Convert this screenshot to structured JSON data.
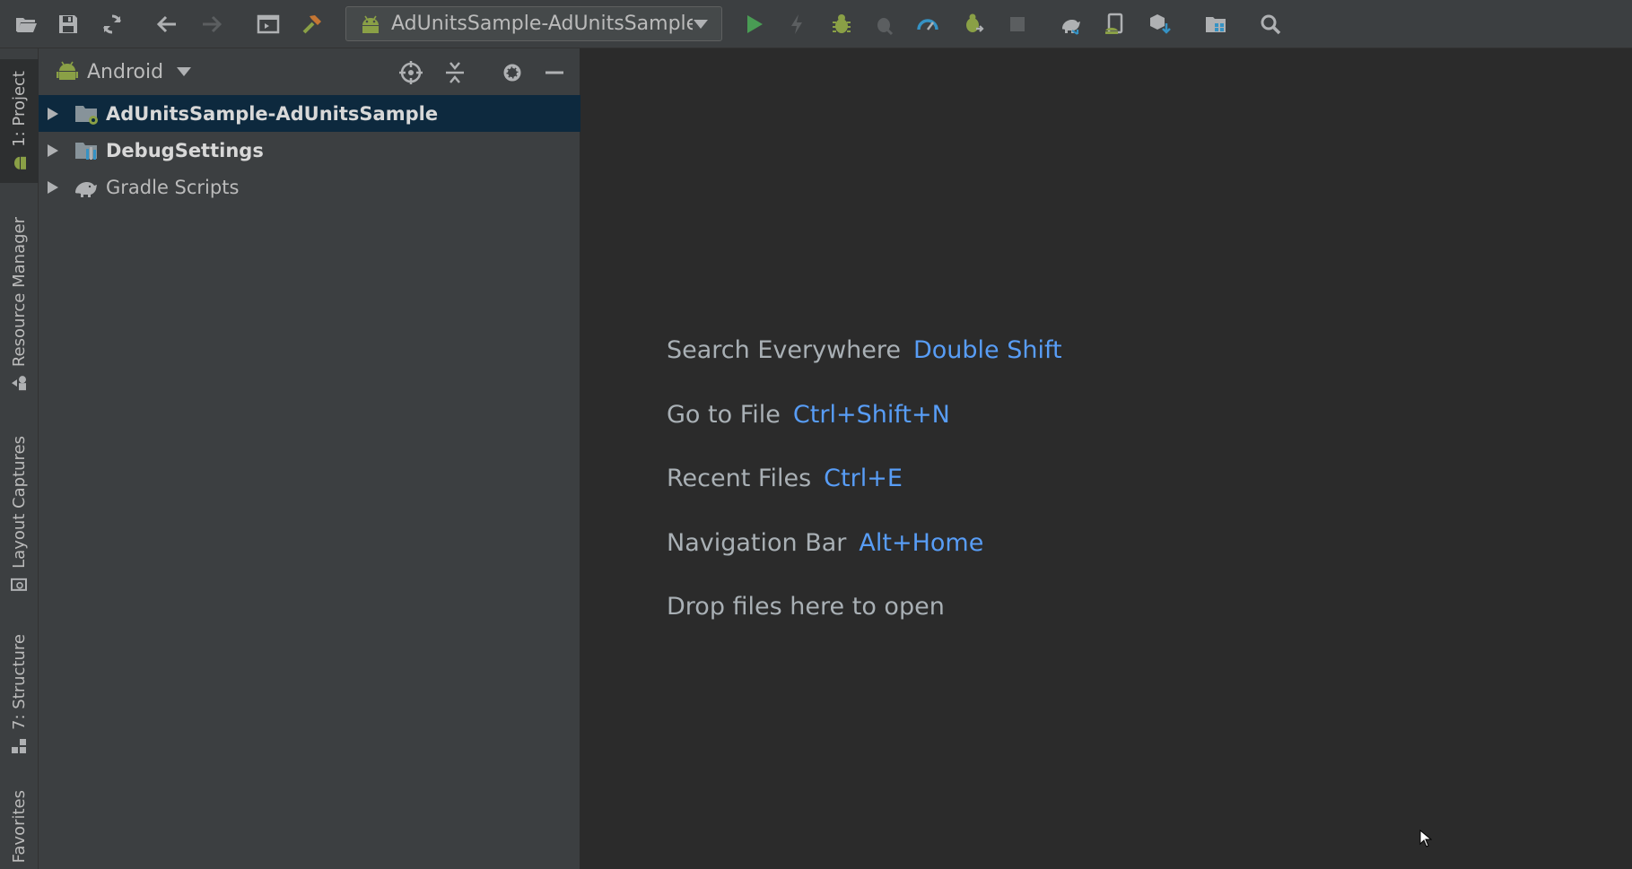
{
  "toolbar": {
    "buttons": [
      {
        "name": "open-folder-icon"
      },
      {
        "name": "save-icon"
      },
      {
        "name": "sync-icon"
      },
      {
        "name": "back-arrow-icon"
      },
      {
        "name": "forward-arrow-icon"
      },
      {
        "name": "terminal-icon"
      },
      {
        "name": "build-hammer-icon"
      }
    ],
    "run_config": "AdUnitsSample-AdUnitsSample",
    "colors": {
      "run": "#499c54",
      "debug": "#8aa046",
      "profile": "#3592c4",
      "build": "#c57633"
    }
  },
  "tool_strip": {
    "tabs": [
      {
        "label": "1: Project",
        "active": true
      },
      {
        "label": "Resource Manager",
        "active": false
      },
      {
        "label": "Layout Captures",
        "active": false
      },
      {
        "label": "7: Structure",
        "active": false
      },
      {
        "label": "Favorites",
        "active": false
      }
    ]
  },
  "project_panel": {
    "view_mode": "Android",
    "tree": [
      {
        "label": "AdUnitsSample-AdUnitsSample",
        "bold": true,
        "selected": true,
        "icon": "module-folder-icon"
      },
      {
        "label": "DebugSettings",
        "bold": true,
        "selected": false,
        "icon": "library-module-icon"
      },
      {
        "label": "Gradle Scripts",
        "bold": false,
        "selected": false,
        "icon": "gradle-elephant-icon"
      }
    ]
  },
  "editor": {
    "hints": [
      {
        "text": "Search Everywhere",
        "shortcut": "Double Shift"
      },
      {
        "text": "Go to File",
        "shortcut": "Ctrl+Shift+N"
      },
      {
        "text": "Recent Files",
        "shortcut": "Ctrl+E"
      },
      {
        "text": "Navigation Bar",
        "shortcut": "Alt+Home"
      },
      {
        "text": "Drop files here to open",
        "shortcut": ""
      }
    ]
  }
}
